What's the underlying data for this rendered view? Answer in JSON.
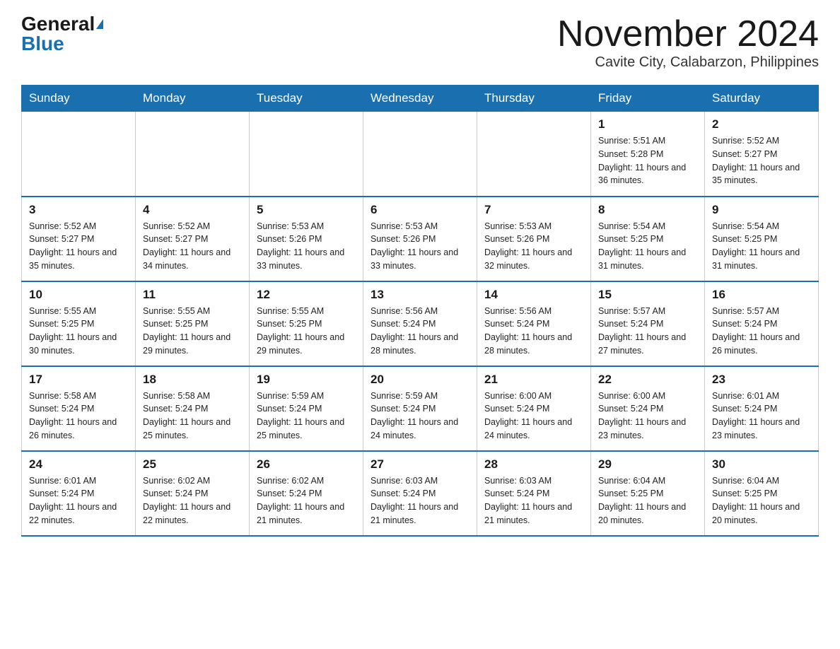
{
  "header": {
    "logo_general": "General",
    "logo_blue": "Blue",
    "month_title": "November 2024",
    "location": "Cavite City, Calabarzon, Philippines"
  },
  "weekdays": [
    "Sunday",
    "Monday",
    "Tuesday",
    "Wednesday",
    "Thursday",
    "Friday",
    "Saturday"
  ],
  "weeks": [
    {
      "days": [
        {
          "num": "",
          "info": ""
        },
        {
          "num": "",
          "info": ""
        },
        {
          "num": "",
          "info": ""
        },
        {
          "num": "",
          "info": ""
        },
        {
          "num": "",
          "info": ""
        },
        {
          "num": "1",
          "info": "Sunrise: 5:51 AM\nSunset: 5:28 PM\nDaylight: 11 hours and 36 minutes."
        },
        {
          "num": "2",
          "info": "Sunrise: 5:52 AM\nSunset: 5:27 PM\nDaylight: 11 hours and 35 minutes."
        }
      ]
    },
    {
      "days": [
        {
          "num": "3",
          "info": "Sunrise: 5:52 AM\nSunset: 5:27 PM\nDaylight: 11 hours and 35 minutes."
        },
        {
          "num": "4",
          "info": "Sunrise: 5:52 AM\nSunset: 5:27 PM\nDaylight: 11 hours and 34 minutes."
        },
        {
          "num": "5",
          "info": "Sunrise: 5:53 AM\nSunset: 5:26 PM\nDaylight: 11 hours and 33 minutes."
        },
        {
          "num": "6",
          "info": "Sunrise: 5:53 AM\nSunset: 5:26 PM\nDaylight: 11 hours and 33 minutes."
        },
        {
          "num": "7",
          "info": "Sunrise: 5:53 AM\nSunset: 5:26 PM\nDaylight: 11 hours and 32 minutes."
        },
        {
          "num": "8",
          "info": "Sunrise: 5:54 AM\nSunset: 5:25 PM\nDaylight: 11 hours and 31 minutes."
        },
        {
          "num": "9",
          "info": "Sunrise: 5:54 AM\nSunset: 5:25 PM\nDaylight: 11 hours and 31 minutes."
        }
      ]
    },
    {
      "days": [
        {
          "num": "10",
          "info": "Sunrise: 5:55 AM\nSunset: 5:25 PM\nDaylight: 11 hours and 30 minutes."
        },
        {
          "num": "11",
          "info": "Sunrise: 5:55 AM\nSunset: 5:25 PM\nDaylight: 11 hours and 29 minutes."
        },
        {
          "num": "12",
          "info": "Sunrise: 5:55 AM\nSunset: 5:25 PM\nDaylight: 11 hours and 29 minutes."
        },
        {
          "num": "13",
          "info": "Sunrise: 5:56 AM\nSunset: 5:24 PM\nDaylight: 11 hours and 28 minutes."
        },
        {
          "num": "14",
          "info": "Sunrise: 5:56 AM\nSunset: 5:24 PM\nDaylight: 11 hours and 28 minutes."
        },
        {
          "num": "15",
          "info": "Sunrise: 5:57 AM\nSunset: 5:24 PM\nDaylight: 11 hours and 27 minutes."
        },
        {
          "num": "16",
          "info": "Sunrise: 5:57 AM\nSunset: 5:24 PM\nDaylight: 11 hours and 26 minutes."
        }
      ]
    },
    {
      "days": [
        {
          "num": "17",
          "info": "Sunrise: 5:58 AM\nSunset: 5:24 PM\nDaylight: 11 hours and 26 minutes."
        },
        {
          "num": "18",
          "info": "Sunrise: 5:58 AM\nSunset: 5:24 PM\nDaylight: 11 hours and 25 minutes."
        },
        {
          "num": "19",
          "info": "Sunrise: 5:59 AM\nSunset: 5:24 PM\nDaylight: 11 hours and 25 minutes."
        },
        {
          "num": "20",
          "info": "Sunrise: 5:59 AM\nSunset: 5:24 PM\nDaylight: 11 hours and 24 minutes."
        },
        {
          "num": "21",
          "info": "Sunrise: 6:00 AM\nSunset: 5:24 PM\nDaylight: 11 hours and 24 minutes."
        },
        {
          "num": "22",
          "info": "Sunrise: 6:00 AM\nSunset: 5:24 PM\nDaylight: 11 hours and 23 minutes."
        },
        {
          "num": "23",
          "info": "Sunrise: 6:01 AM\nSunset: 5:24 PM\nDaylight: 11 hours and 23 minutes."
        }
      ]
    },
    {
      "days": [
        {
          "num": "24",
          "info": "Sunrise: 6:01 AM\nSunset: 5:24 PM\nDaylight: 11 hours and 22 minutes."
        },
        {
          "num": "25",
          "info": "Sunrise: 6:02 AM\nSunset: 5:24 PM\nDaylight: 11 hours and 22 minutes."
        },
        {
          "num": "26",
          "info": "Sunrise: 6:02 AM\nSunset: 5:24 PM\nDaylight: 11 hours and 21 minutes."
        },
        {
          "num": "27",
          "info": "Sunrise: 6:03 AM\nSunset: 5:24 PM\nDaylight: 11 hours and 21 minutes."
        },
        {
          "num": "28",
          "info": "Sunrise: 6:03 AM\nSunset: 5:24 PM\nDaylight: 11 hours and 21 minutes."
        },
        {
          "num": "29",
          "info": "Sunrise: 6:04 AM\nSunset: 5:25 PM\nDaylight: 11 hours and 20 minutes."
        },
        {
          "num": "30",
          "info": "Sunrise: 6:04 AM\nSunset: 5:25 PM\nDaylight: 11 hours and 20 minutes."
        }
      ]
    }
  ]
}
